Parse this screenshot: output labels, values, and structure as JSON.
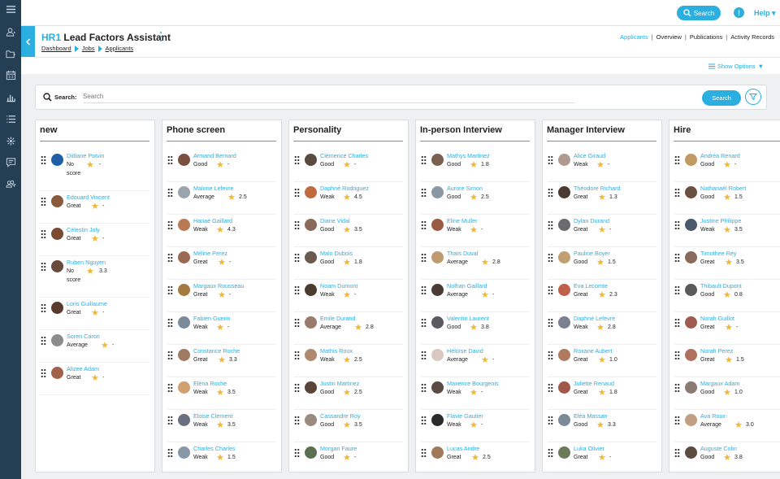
{
  "app": {
    "title_prefix": "HR1",
    "title": "Lead Factors Assistant",
    "help": "Help",
    "top_search": "Search",
    "alert": "!"
  },
  "breadcrumb": [
    "Dashboard",
    "Jobs",
    "Applicants"
  ],
  "nav": [
    "Applicants",
    "Overview",
    "Publications",
    "Activity Records"
  ],
  "show_options": "Show Options",
  "search": {
    "label": "Search:",
    "placeholder": "Search",
    "button": "Search"
  },
  "colors": {
    "accent": "#2baee0",
    "sidebar": "#243e54",
    "star": "#f2b632"
  },
  "sidebar_icons": [
    "menu-icon",
    "user-icon",
    "folder-icon",
    "calendar-icon",
    "chart-icon",
    "list-icon",
    "gear-icon",
    "message-icon",
    "users-icon"
  ],
  "columns": [
    {
      "title": "new",
      "cards": [
        {
          "name": "Didiane Potvin",
          "rating": "No score",
          "score": "-",
          "avatar": "#1e5fa8"
        },
        {
          "name": "Edouard Vincent",
          "rating": "Great",
          "score": "-",
          "avatar": "#8a5a3c"
        },
        {
          "name": "Célestin Joly",
          "rating": "Great",
          "score": "-",
          "avatar": "#7b4a35"
        },
        {
          "name": "Ruben Nguyen",
          "rating": "No score",
          "score": "3.3",
          "avatar": "#6a4a3a"
        },
        {
          "name": "Loris Guillaume",
          "rating": "Great",
          "score": "-",
          "avatar": "#5a3a2c"
        },
        {
          "name": "Soren Caron",
          "rating": "Average",
          "score": "-",
          "avatar": "#8c8c8c"
        },
        {
          "name": "Alizee Adam",
          "rating": "Great",
          "score": "-",
          "avatar": "#a0624a"
        }
      ]
    },
    {
      "title": "Phone screen",
      "cards": [
        {
          "name": "Armand Bernard",
          "rating": "Good",
          "score": "-",
          "avatar": "#7a5040"
        },
        {
          "name": "Malone Lefevre",
          "rating": "Average",
          "score": "2.5",
          "avatar": "#9aa4ae"
        },
        {
          "name": "Hanaé Gaillard",
          "rating": "Weak",
          "score": "4.3",
          "avatar": "#b87a52"
        },
        {
          "name": "Méline Perez",
          "rating": "Great",
          "score": "-",
          "avatar": "#9a6a54"
        },
        {
          "name": "Margaux Rousseau",
          "rating": "Great",
          "score": "-",
          "avatar": "#a57a40"
        },
        {
          "name": "Fabien Guerin",
          "rating": "Weak",
          "score": "-",
          "avatar": "#7a8a9a"
        },
        {
          "name": "Constance Roche",
          "rating": "Great",
          "score": "3.3",
          "avatar": "#a07a62"
        },
        {
          "name": "Eléna Roche",
          "rating": "Weak",
          "score": "3.5",
          "avatar": "#d0a070"
        },
        {
          "name": "Eloise Clement",
          "rating": "Weak",
          "score": "3.5",
          "avatar": "#6a7080"
        },
        {
          "name": "Charles Charles",
          "rating": "Weak",
          "score": "1.5",
          "avatar": "#8898a8"
        }
      ]
    },
    {
      "title": "Personality",
      "cards": [
        {
          "name": "Clémence Charles",
          "rating": "Good",
          "score": "-",
          "avatar": "#5a4a40"
        },
        {
          "name": "Daphné Rodriguez",
          "rating": "Weak",
          "score": "4.5",
          "avatar": "#c06a40"
        },
        {
          "name": "Diane Vidal",
          "rating": "Good",
          "score": "3.5",
          "avatar": "#8a6a5a"
        },
        {
          "name": "Malo Dubois",
          "rating": "Good",
          "score": "1.8",
          "avatar": "#6a5a50"
        },
        {
          "name": "Noam Dumont",
          "rating": "Weak",
          "score": "-",
          "avatar": "#4a3a30"
        },
        {
          "name": "Emile Durand",
          "rating": "Average",
          "score": "2.8",
          "avatar": "#9a7a6a"
        },
        {
          "name": "Mathis Roux",
          "rating": "Weak",
          "score": "2.5",
          "avatar": "#b08a70"
        },
        {
          "name": "Justin Martinez",
          "rating": "Good",
          "score": "2.5",
          "avatar": "#5a4438"
        },
        {
          "name": "Cassandre Roy",
          "rating": "Good",
          "score": "3.5",
          "avatar": "#9a8a80"
        },
        {
          "name": "Morgan Faure",
          "rating": "Good",
          "score": "-",
          "avatar": "#5a7050"
        }
      ]
    },
    {
      "title": "In-person Interview",
      "cards": [
        {
          "name": "Mathys Martinez",
          "rating": "Good",
          "score": "1.8",
          "avatar": "#7a6050"
        },
        {
          "name": "Aurore Simon",
          "rating": "Good",
          "score": "2.5",
          "avatar": "#8a98a4"
        },
        {
          "name": "Eline Muller",
          "rating": "Weak",
          "score": "-",
          "avatar": "#9a5a44"
        },
        {
          "name": "Thaïs Duval",
          "rating": "Average",
          "score": "2.8",
          "avatar": "#c09a70"
        },
        {
          "name": "Nolhan Gaillard",
          "rating": "Average",
          "score": "-",
          "avatar": "#4a3a34"
        },
        {
          "name": "Valentin Laurent",
          "rating": "Good",
          "score": "3.8",
          "avatar": "#5a5a60"
        },
        {
          "name": "Héloïse David",
          "rating": "Average",
          "score": "-",
          "avatar": "#d8c8c0"
        },
        {
          "name": "Maxence Bourgeois",
          "rating": "Weak",
          "score": "-",
          "avatar": "#5a4a44"
        },
        {
          "name": "Flavie Gautier",
          "rating": "Weak",
          "score": "-",
          "avatar": "#2a2a2a"
        },
        {
          "name": "Lucas Andre",
          "rating": "Great",
          "score": "2.5",
          "avatar": "#a07a5a"
        }
      ]
    },
    {
      "title": "Manager Interview",
      "cards": [
        {
          "name": "Alice Giraud",
          "rating": "Weak",
          "score": "-",
          "avatar": "#b09a90"
        },
        {
          "name": "Théodore Richard",
          "rating": "Great",
          "score": "1.3",
          "avatar": "#4a3a30"
        },
        {
          "name": "Dylan Durand",
          "rating": "Great",
          "score": "-",
          "avatar": "#6a6a70"
        },
        {
          "name": "Pauline Boyer",
          "rating": "Good",
          "score": "1.5",
          "avatar": "#c0a070"
        },
        {
          "name": "Eva Lecomte",
          "rating": "Great",
          "score": "2.3",
          "avatar": "#c0604a"
        },
        {
          "name": "Daphné Lefevre",
          "rating": "Weak",
          "score": "2.8",
          "avatar": "#7a8090"
        },
        {
          "name": "Roxane Aubert",
          "rating": "Great",
          "score": "1.0",
          "avatar": "#b07a60"
        },
        {
          "name": "Juliette Renaud",
          "rating": "Great",
          "score": "1.8",
          "avatar": "#a0584a"
        },
        {
          "name": "Eléa Massan",
          "rating": "Good",
          "score": "3.3",
          "avatar": "#7a8a98"
        },
        {
          "name": "Luka Olivier",
          "rating": "Great",
          "score": "-",
          "avatar": "#6a7a5a"
        }
      ]
    },
    {
      "title": "Hire",
      "cards": [
        {
          "name": "Andréa Renard",
          "rating": "Good",
          "score": "-",
          "avatar": "#c09a60"
        },
        {
          "name": "Nathanaël Robert",
          "rating": "Good",
          "score": "1.5",
          "avatar": "#6a5040"
        },
        {
          "name": "Justine Philippe",
          "rating": "Weak",
          "score": "3.5",
          "avatar": "#4a5a6a"
        },
        {
          "name": "Timothee Rey",
          "rating": "Great",
          "score": "3.5",
          "avatar": "#8a6a5a"
        },
        {
          "name": "Thibault Dupont",
          "rating": "Good",
          "score": "0.8",
          "avatar": "#5a5a5a"
        },
        {
          "name": "Norah Guillot",
          "rating": "Great",
          "score": "-",
          "avatar": "#a05a50"
        },
        {
          "name": "Norah Perez",
          "rating": "Great",
          "score": "1.5",
          "avatar": "#b07060"
        },
        {
          "name": "Margaux Adam",
          "rating": "Good",
          "score": "1.0",
          "avatar": "#8a7a70"
        },
        {
          "name": "Ava Roux",
          "rating": "Average",
          "score": "3.0",
          "avatar": "#c0a080"
        },
        {
          "name": "Auguste Colin",
          "rating": "Good",
          "score": "3.8",
          "avatar": "#5a4a40"
        }
      ]
    }
  ]
}
